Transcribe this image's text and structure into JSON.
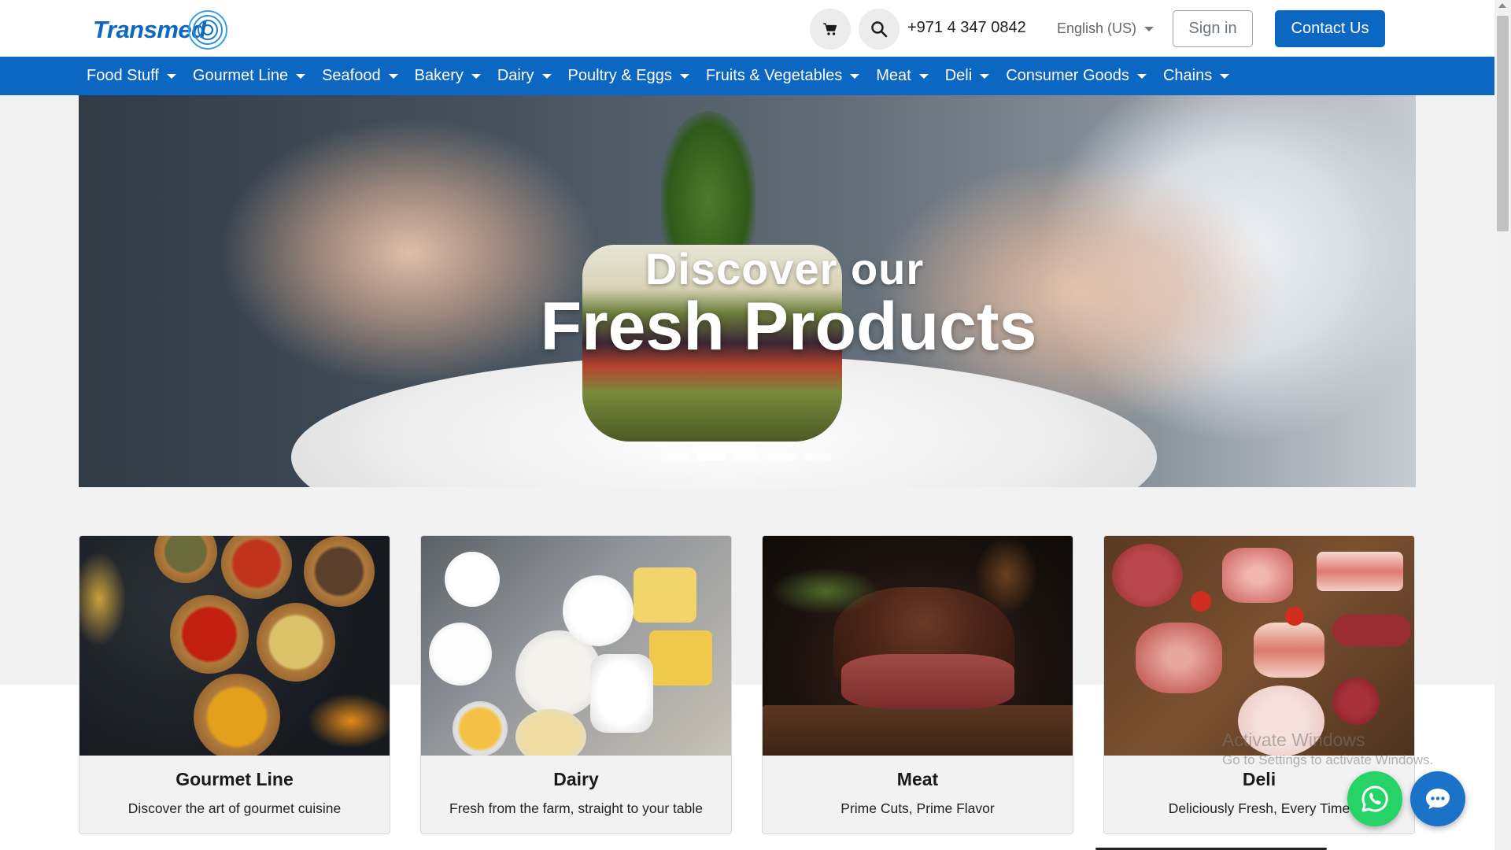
{
  "header": {
    "logo_text": "Transmed",
    "phone": "+971 4 347 0842",
    "language": "English (US)",
    "sign_in": "Sign in",
    "contact": "Contact Us",
    "icons": {
      "cart": "cart-icon",
      "search": "search-icon"
    }
  },
  "nav": {
    "items": [
      {
        "label": "Food Stuff"
      },
      {
        "label": "Gourmet Line"
      },
      {
        "label": "Seafood"
      },
      {
        "label": "Bakery"
      },
      {
        "label": "Dairy"
      },
      {
        "label": "Poultry & Eggs"
      },
      {
        "label": "Fruits & Vegetables"
      },
      {
        "label": "Meat"
      },
      {
        "label": "Deli"
      },
      {
        "label": "Consumer Goods"
      },
      {
        "label": "Chains"
      }
    ]
  },
  "hero": {
    "line1": "Discover our",
    "line2": "Fresh Products",
    "slides_total": 5,
    "active_slide": 2
  },
  "cards": [
    {
      "title": "Gourmet Line",
      "subtitle": "Discover the art of gourmet cuisine"
    },
    {
      "title": "Dairy",
      "subtitle": "Fresh from the farm, straight to your table"
    },
    {
      "title": "Meat",
      "subtitle": "Prime Cuts, Prime Flavor"
    },
    {
      "title": "Deli",
      "subtitle": "Deliciously Fresh, Every Time"
    }
  ],
  "os_watermark": {
    "line1": "Activate Windows",
    "line2": "Go to Settings to activate Windows."
  },
  "colors": {
    "brand_blue": "#0b67c2",
    "whatsapp_green": "#25d366",
    "chat_blue": "#1a73c9"
  }
}
